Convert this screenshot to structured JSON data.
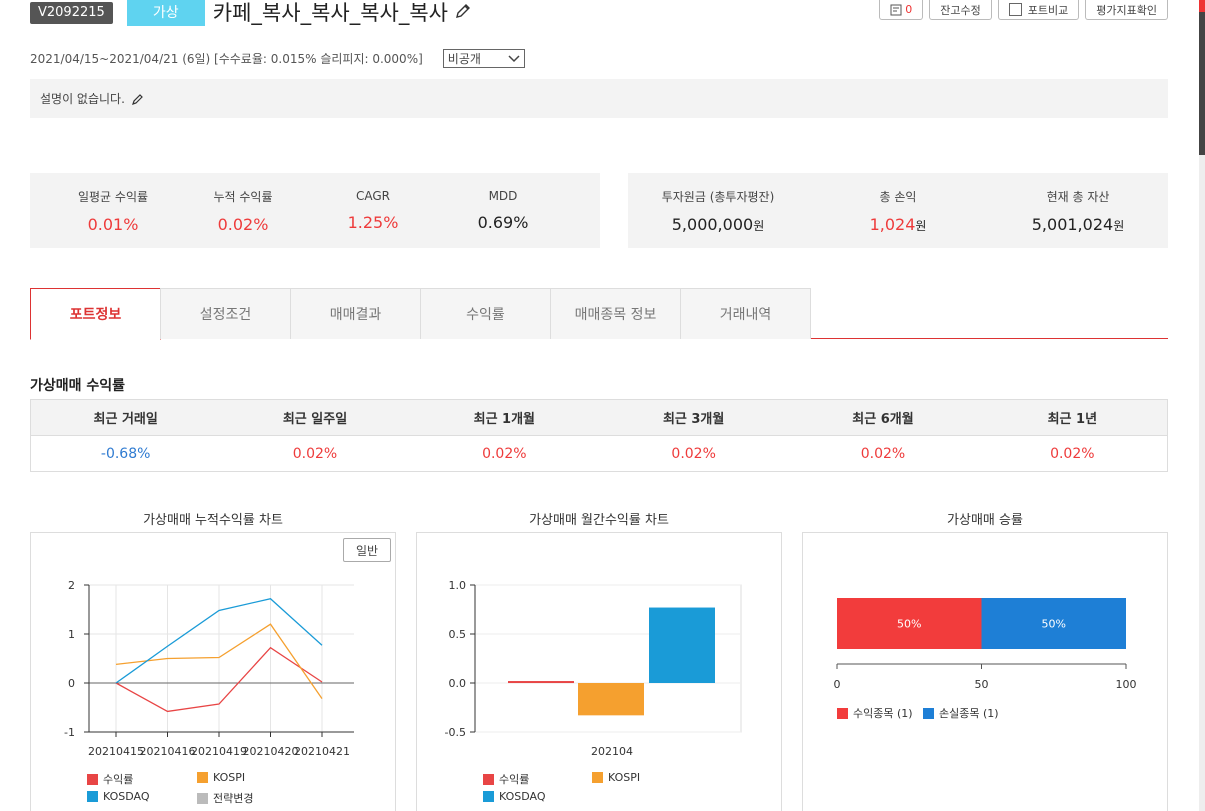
{
  "header": {
    "code": "V2092215",
    "type_badge": "가상",
    "title": "카페_복사_복사_복사_복사",
    "buttons": {
      "memo_count": "0",
      "balance_edit": "잔고수정",
      "compare": "포트비교",
      "evaluate": "평가지표확인"
    }
  },
  "info": {
    "period": "2021/04/15~2021/04/21 (6일) [수수료율: 0.015% 슬리피지: 0.000%]",
    "visibility": "비공개",
    "description": "설명이 없습니다."
  },
  "stats_left": [
    {
      "label": "일평균 수익률",
      "value": "0.01%",
      "color": "#ee3b3b"
    },
    {
      "label": "누적 수익률",
      "value": "0.02%",
      "color": "#ee3b3b"
    },
    {
      "label": "CAGR",
      "value": "1.25%",
      "color": "#ee3b3b"
    },
    {
      "label": "MDD",
      "value": "0.69%",
      "color": "#222222"
    }
  ],
  "stats_right": [
    {
      "label": "투자원금 (총투자평잔)",
      "value": "5,000,000",
      "unit": "원",
      "color": "#222222"
    },
    {
      "label": "총 손익",
      "value": "1,024",
      "unit": "원",
      "color": "#ee3b3b"
    },
    {
      "label": "현재 총 자산",
      "value": "5,001,024",
      "unit": "원",
      "color": "#222222"
    }
  ],
  "tabs": [
    "포트정보",
    "설정조건",
    "매매결과",
    "수익률",
    "매매종목 정보",
    "거래내역"
  ],
  "returns": {
    "title": "가상매매 수익률",
    "headers": [
      "최근 거래일",
      "최근 일주일",
      "최근 1개월",
      "최근 3개월",
      "최근 6개월",
      "최근 1년"
    ],
    "values": [
      "-0.68%",
      "0.02%",
      "0.02%",
      "0.02%",
      "0.02%",
      "0.02%"
    ]
  },
  "charts": {
    "cumulative_title": "가상매매 누적수익률 차트",
    "monthly_title": "가상매매 월간수익률 차트",
    "winrate_title": "가상매매 승률",
    "normal_button": "일반",
    "legend_cum": [
      "수익률",
      "KOSPI",
      "KOSDAQ",
      "전략변경"
    ],
    "legend_monthly": [
      "수익률",
      "KOSPI",
      "KOSDAQ"
    ],
    "legend_win": [
      "수익종목 (1)",
      "손실종목 (1)"
    ],
    "colors": {
      "return": "#e84545",
      "kospi": "#f5a02f",
      "kosdaq": "#1a9bd7",
      "strategy": "#bbbbbb",
      "win_red": "#f23c3c",
      "win_blue": "#1e7fd6"
    }
  },
  "chart_data": [
    {
      "type": "line",
      "title": "가상매매 누적수익률 차트",
      "categories": [
        "20210415",
        "20210416",
        "20210419",
        "20210420",
        "20210421"
      ],
      "ylim": [
        -1,
        2
      ],
      "yticks": [
        "2",
        "1",
        "0",
        "-1"
      ],
      "series": [
        {
          "name": "수익률",
          "values": [
            0,
            -0.58,
            -0.43,
            0.72,
            0.02
          ]
        },
        {
          "name": "KOSPI",
          "values": [
            0.38,
            0.5,
            0.52,
            1.2,
            -0.32
          ]
        },
        {
          "name": "KOSDAQ",
          "values": [
            0.0,
            0.75,
            1.48,
            1.72,
            0.77
          ]
        }
      ]
    },
    {
      "type": "bar",
      "title": "가상매매 월간수익률 차트",
      "categories": [
        "202104"
      ],
      "ylim": [
        -0.5,
        1.0
      ],
      "yticks": [
        "1.0",
        "0.5",
        "0.0",
        "-0.5"
      ],
      "series": [
        {
          "name": "수익률",
          "values": [
            0.02
          ]
        },
        {
          "name": "KOSPI",
          "values": [
            -0.33
          ]
        },
        {
          "name": "KOSDAQ",
          "values": [
            0.77
          ]
        }
      ]
    },
    {
      "type": "bar",
      "title": "가상매매 승률",
      "stacked": true,
      "xlim": [
        0,
        100
      ],
      "xticks": [
        "0",
        "50",
        "100"
      ],
      "series": [
        {
          "name": "수익종목 (1)",
          "values": [
            50
          ],
          "label": "50%"
        },
        {
          "name": "손실종목 (1)",
          "values": [
            50
          ],
          "label": "50%"
        }
      ]
    }
  ]
}
